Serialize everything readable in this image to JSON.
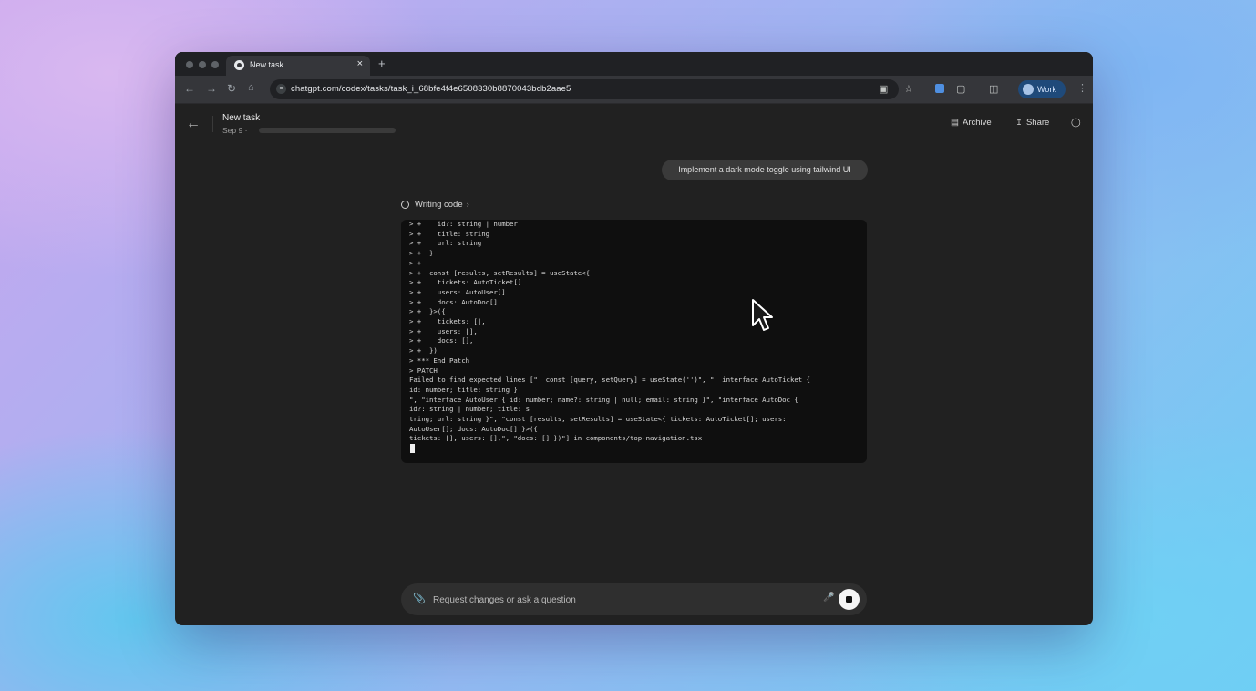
{
  "browser": {
    "tab_title": "New task",
    "tab_close": "×",
    "new_tab": "+",
    "url": "chatgpt.com/codex/tasks/task_i_68bfe4f4e6508330b8870043bdb2aae5",
    "profile_label": "Work"
  },
  "header": {
    "title": "New task",
    "date": "Sep 9",
    "separator": "·",
    "archive_label": "Archive",
    "share_label": "Share"
  },
  "conversation": {
    "user_message": "Implement a dark mode toggle using tailwind UI",
    "status_label": "Writing code",
    "terminal_lines": [
      "> +    id?: string | number",
      "> +    title: string",
      "> +    url: string",
      "> +  }",
      "> +",
      "> +  const [results, setResults] = useState<{",
      "> +    tickets: AutoTicket[]",
      "> +    users: AutoUser[]",
      "> +    docs: AutoDoc[]",
      "> +  }>({",
      "> +    tickets: [],",
      "> +    users: [],",
      "> +    docs: [],",
      "> +  })",
      "> *** End Patch",
      "> PATCH",
      "Failed to find expected lines [\"  const [query, setQuery] = useState('')\", \"  interface AutoTicket {",
      "id: number; title: string }",
      "\", \"interface AutoUser { id: number; name?: string | null; email: string }\", \"interface AutoDoc {",
      "id?: string | number; title: s",
      "tring; url: string }\", \"const [results, setResults] = useState<{ tickets: AutoTicket[]; users:",
      "AutoUser[]; docs: AutoDoc[] }>({",
      "tickets: [], users: [],\", \"docs: [] })\"] in components/top-navigation.tsx"
    ]
  },
  "composer": {
    "placeholder": "Request changes or ask a question"
  },
  "icons": {
    "back": "arrow-left-icon",
    "archive": "archive-icon",
    "share": "share-icon",
    "notifications": "bell-icon",
    "attach": "paperclip-icon",
    "mic": "microphone-icon",
    "stop": "stop-icon"
  },
  "colors": {
    "window_bg": "#212121",
    "terminal_bg": "#0f0f0f",
    "bubble_bg": "#3a3a3a",
    "profile_chip": "#1f4a7a"
  }
}
